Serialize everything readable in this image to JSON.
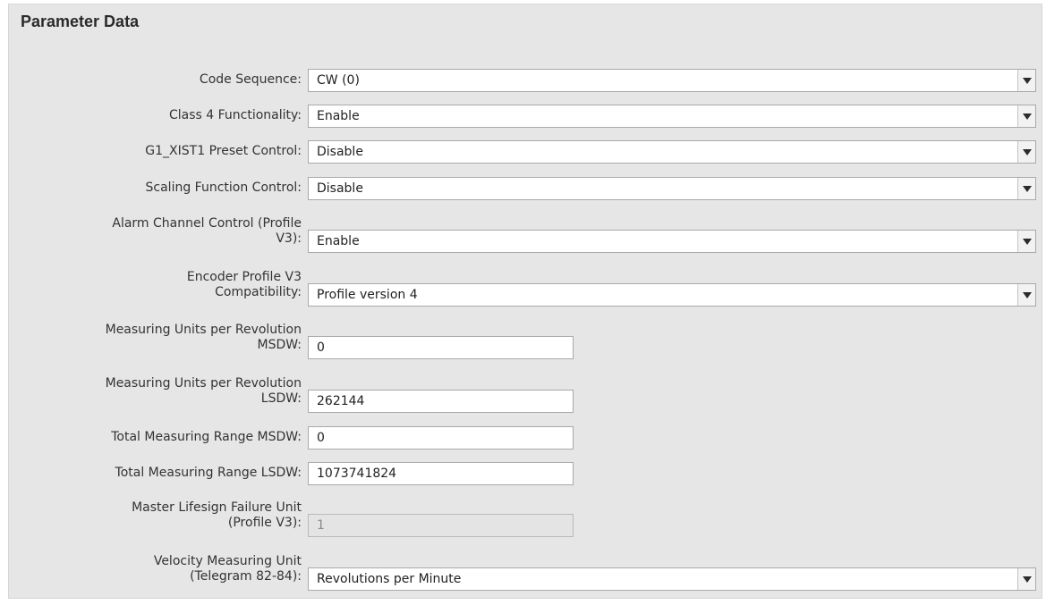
{
  "panel": {
    "title": "Parameter Data"
  },
  "fields": {
    "code_sequence": {
      "label": "Code Sequence:",
      "value": "CW (0)"
    },
    "class4": {
      "label": "Class 4 Functionality:",
      "value": "Enable"
    },
    "g1_preset": {
      "label": "G1_XIST1 Preset Control:",
      "value": "Disable"
    },
    "scaling": {
      "label": "Scaling Function Control:",
      "value": "Disable"
    },
    "alarm_channel": {
      "label_line1": "Alarm Channel Control (Profile",
      "label_line2": "V3):",
      "value": "Enable"
    },
    "encoder_profile": {
      "label_line1": "Encoder Profile V3",
      "label_line2": "Compatibility:",
      "value": "Profile version 4"
    },
    "mu_msdw": {
      "label_line1": "Measuring Units per Revolution",
      "label_line2": "MSDW:",
      "value": "0"
    },
    "mu_lsdw": {
      "label_line1": "Measuring Units per Revolution",
      "label_line2": "LSDW:",
      "value": "262144"
    },
    "tmr_msdw": {
      "label": "Total Measuring Range MSDW:",
      "value": "0"
    },
    "tmr_lsdw": {
      "label": "Total Measuring Range LSDW:",
      "value": "1073741824"
    },
    "lifesign": {
      "label_line1": "Master Lifesign Failure Unit",
      "label_line2": "(Profile V3):",
      "value": "1"
    },
    "velocity_unit": {
      "label_line1": "Velocity Measuring Unit",
      "label_line2": "(Telegram 82-84):",
      "value": "Revolutions per Minute"
    }
  },
  "icons": {
    "dropdown": "chevron-down-icon"
  }
}
